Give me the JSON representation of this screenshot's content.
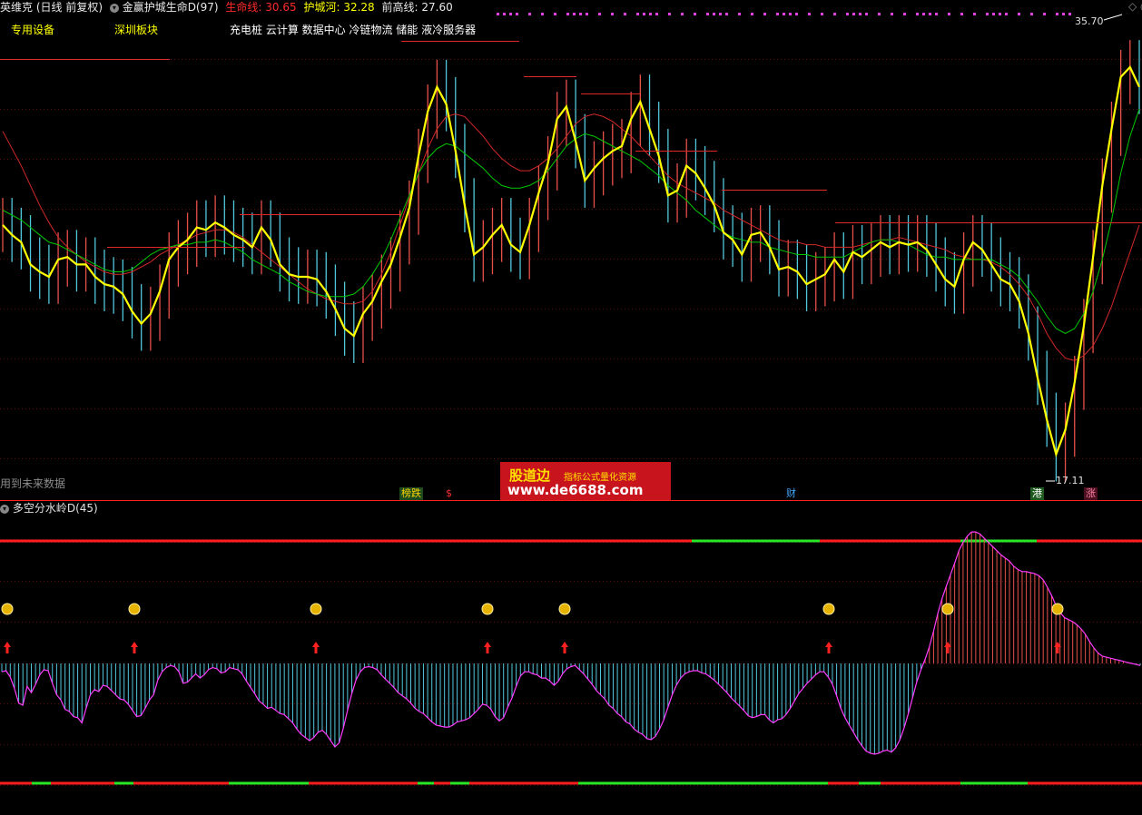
{
  "header": {
    "stock_name": "英维克",
    "period": "(日线 前复权)",
    "indicator_name": "金赢护城生命D(97)",
    "life_label": "生命线:",
    "life_value": "30.65",
    "moat_label": "护城河:",
    "moat_value": "32.28",
    "prev_high_label": "前高线:",
    "prev_high_value": "27.60"
  },
  "tags": {
    "tag1": "专用设备",
    "tag2": "深圳板块",
    "concepts": "充电桩 云计算 数据中心 冷链物流 储能 液冷服务器"
  },
  "price_labels": {
    "high": "35.70",
    "low": "17.11"
  },
  "future_data_note": "用到未来数据",
  "markers": {
    "m1": "榜跌",
    "m2": "$",
    "m3": "财",
    "m4": "港",
    "m5": "涨"
  },
  "watermark": {
    "name": "股道边",
    "subtitle": "指标公式量化资源",
    "url": "www.de6688.com"
  },
  "sub_panel": {
    "title": "多空分水岭D(45)"
  },
  "colors": {
    "yellow_line": "#ffff00",
    "green_line": "#00c800",
    "red_line": "#d22828",
    "up_bar": "#e8504a",
    "down_bar": "#52c8dc",
    "magenta": "#ff3cff",
    "level_red": "#ff1e1e",
    "level_green": "#28e628"
  },
  "chart_data": [
    {
      "type": "line",
      "series": [
        {
          "values": [
            27.2,
            26.8,
            26.5,
            25.6,
            25.3,
            25.1,
            25.8,
            25.9,
            25.6,
            25.6,
            25.1,
            24.8,
            24.7,
            24.4,
            23.7,
            23.2,
            23.6,
            24.5,
            25.8,
            26.3,
            26.6,
            27.1,
            27.0,
            27.3,
            27.1,
            26.8,
            26.6,
            26.3,
            27.1,
            26.6,
            25.6,
            25.2,
            25.1,
            25.1,
            25.0,
            24.5,
            23.8,
            23.0,
            22.7,
            23.6,
            24.1,
            24.9,
            25.6,
            26.7,
            27.9,
            30.0,
            31.8,
            32.8,
            32.1,
            30.2,
            28.0,
            26.0,
            26.3,
            26.8,
            27.2,
            26.4,
            26.1,
            27.2,
            28.5,
            29.7,
            31.5,
            32.0,
            30.6,
            29.0,
            29.5,
            29.9,
            30.2,
            30.4,
            31.5,
            32.2,
            31.1,
            30.0,
            28.4,
            28.6,
            29.6,
            29.3,
            28.7,
            28.0,
            26.9,
            26.6,
            26.0,
            26.8,
            26.9,
            26.3,
            25.4,
            25.5,
            25.3,
            24.8,
            25.0,
            25.2,
            25.8,
            25.3,
            26.1,
            25.9,
            26.2,
            26.5,
            26.3,
            26.5,
            26.4,
            26.5,
            26.2,
            25.6,
            25.0,
            24.7,
            25.8,
            26.5,
            26.2,
            25.6,
            25.0,
            24.8,
            24.1,
            22.8,
            21.0,
            19.3,
            17.9,
            18.9,
            20.8,
            23.1,
            25.9,
            28.8,
            31.1,
            33.2,
            33.6,
            32.8
          ]
        },
        {
          "values": [
            27.8,
            27.6,
            27.4,
            27.1,
            26.8,
            26.5,
            26.4,
            26.2,
            26.0,
            25.8,
            25.6,
            25.4,
            25.3,
            25.3,
            25.4,
            25.7,
            26.0,
            26.2,
            26.3,
            26.4,
            26.4,
            26.5,
            26.5,
            26.6,
            26.5,
            26.3,
            26.1,
            25.8,
            25.6,
            25.4,
            25.2,
            24.9,
            24.7,
            24.5,
            24.4,
            24.3,
            24.3,
            24.3,
            24.4,
            24.7,
            25.2,
            25.8,
            26.6,
            27.5,
            28.4,
            29.3,
            29.9,
            30.3,
            30.5,
            30.4,
            30.1,
            29.8,
            29.5,
            29.1,
            28.8,
            28.7,
            28.7,
            28.8,
            29.0,
            29.4,
            29.9,
            30.4,
            30.7,
            30.9,
            30.8,
            30.6,
            30.4,
            30.2,
            30.0,
            29.8,
            29.5,
            29.2,
            28.8,
            28.5,
            28.2,
            27.8,
            27.5,
            27.2,
            26.9,
            26.7,
            26.6,
            26.5,
            26.5,
            26.3,
            26.2,
            26.1,
            26.0,
            26.0,
            25.9,
            25.9,
            25.9,
            25.9,
            26.1,
            26.3,
            26.5,
            26.6,
            26.6,
            26.5,
            26.4,
            26.2,
            26.0,
            25.9,
            25.9,
            25.8,
            25.8,
            25.8,
            25.8,
            25.8,
            25.6,
            25.4,
            25.1,
            24.6,
            24.1,
            23.5,
            23.0,
            22.8,
            23.0,
            23.6,
            24.5,
            25.8,
            27.4,
            29.3,
            30.8,
            31.9
          ]
        },
        {
          "values": [
            31.0,
            30.3,
            29.6,
            28.8,
            28.0,
            27.3,
            26.7,
            26.3,
            26.0,
            25.7,
            25.5,
            25.3,
            25.2,
            25.2,
            25.3,
            25.5,
            25.7,
            26.0,
            26.2,
            26.4,
            26.6,
            26.8,
            26.9,
            27.0,
            27.0,
            26.9,
            26.7,
            26.4,
            26.1,
            25.8,
            25.5,
            25.2,
            24.9,
            24.6,
            24.4,
            24.2,
            24.1,
            24.0,
            24.0,
            24.1,
            24.5,
            25.2,
            26.1,
            27.2,
            28.3,
            29.3,
            30.3,
            31.1,
            31.6,
            31.7,
            31.6,
            31.2,
            30.8,
            30.3,
            29.9,
            29.6,
            29.4,
            29.4,
            29.6,
            29.9,
            30.3,
            30.8,
            31.3,
            31.6,
            31.7,
            31.6,
            31.4,
            31.1,
            30.8,
            30.4,
            30.0,
            29.6,
            29.2,
            28.9,
            28.7,
            28.5,
            28.3,
            28.1,
            27.8,
            27.6,
            27.4,
            27.2,
            27.0,
            26.8,
            26.6,
            26.5,
            26.5,
            26.4,
            26.4,
            26.3,
            26.3,
            26.3,
            26.3,
            26.4,
            26.5,
            26.6,
            26.6,
            26.7,
            26.6,
            26.5,
            26.4,
            26.3,
            26.2,
            26.0,
            25.9,
            25.8,
            25.8,
            25.7,
            25.5,
            25.2,
            24.8,
            24.3,
            23.6,
            22.8,
            22.2,
            21.8,
            21.7,
            21.9,
            22.3,
            23.0,
            23.9,
            25.0,
            26.1,
            27.2
          ]
        }
      ],
      "annotations": [
        "35.70",
        "17.11"
      ]
    },
    {
      "type": "bar",
      "title": "多空分水岭D(45)",
      "values": [
        -8,
        -7,
        -13,
        -24,
        -38,
        -40,
        -22,
        -28,
        -20,
        -11,
        -6,
        -7,
        -19,
        -30,
        -35,
        -44,
        -46,
        -51,
        -52,
        -57,
        -43,
        -30,
        -25,
        -27,
        -21,
        -22,
        -26,
        -30,
        -34,
        -35,
        -39,
        -45,
        -51,
        -50,
        -43,
        -35,
        -30,
        -16,
        -8,
        -4,
        -2,
        -3,
        -8,
        -19,
        -18,
        -14,
        -10,
        -14,
        -11,
        -6,
        -4,
        -5,
        -9,
        -8,
        -4,
        -5,
        -6,
        -10,
        -17,
        -23,
        -29,
        -36,
        -39,
        -43,
        -42,
        -45,
        -48,
        -49,
        -53,
        -57,
        -63,
        -68,
        -71,
        -74,
        -71,
        -66,
        -64,
        -68,
        -74,
        -80,
        -76,
        -62,
        -45,
        -29,
        -16,
        -8,
        -4,
        -3,
        -4,
        -6,
        -11,
        -15,
        -19,
        -23,
        -28,
        -31,
        -34,
        -38,
        -43,
        -46,
        -48,
        -52,
        -56,
        -59,
        -60,
        -61,
        -61,
        -59,
        -56,
        -55,
        -54,
        -52,
        -48,
        -44,
        -39,
        -40,
        -44,
        -51,
        -55,
        -52,
        -42,
        -33,
        -22,
        -12,
        -8,
        -8,
        -10,
        -11,
        -14,
        -14,
        -17,
        -21,
        -17,
        -10,
        -5,
        -3,
        -2,
        -6,
        -10,
        -15,
        -20,
        -26,
        -30,
        -34,
        -40,
        -43,
        -48,
        -51,
        -56,
        -58,
        -63,
        -66,
        -68,
        -72,
        -73,
        -70,
        -63,
        -54,
        -42,
        -30,
        -21,
        -14,
        -10,
        -8,
        -7,
        -7,
        -9,
        -10,
        -13,
        -16,
        -20,
        -24,
        -28,
        -33,
        -37,
        -41,
        -45,
        -50,
        -52,
        -51,
        -49,
        -49,
        -54,
        -57,
        -54,
        -53,
        -49,
        -43,
        -36,
        -29,
        -24,
        -19,
        -15,
        -11,
        -8,
        -8,
        -13,
        -20,
        -31,
        -43,
        -52,
        -59,
        -66,
        -73,
        -79,
        -84,
        -86,
        -87,
        -86,
        -84,
        -83,
        -85,
        -81,
        -73,
        -62,
        -48,
        -33,
        -18,
        -6,
        4,
        16,
        31,
        48,
        62,
        74,
        85,
        96,
        108,
        116,
        122,
        126,
        126,
        124,
        120,
        116,
        112,
        108,
        104,
        101,
        98,
        93,
        90,
        88,
        88,
        87,
        86,
        84,
        80,
        73,
        65,
        56,
        49,
        44,
        42,
        40,
        37,
        33,
        28,
        21,
        15,
        10,
        7,
        6,
        5,
        4,
        3,
        2,
        1,
        0,
        -1,
        -2
      ]
    }
  ]
}
